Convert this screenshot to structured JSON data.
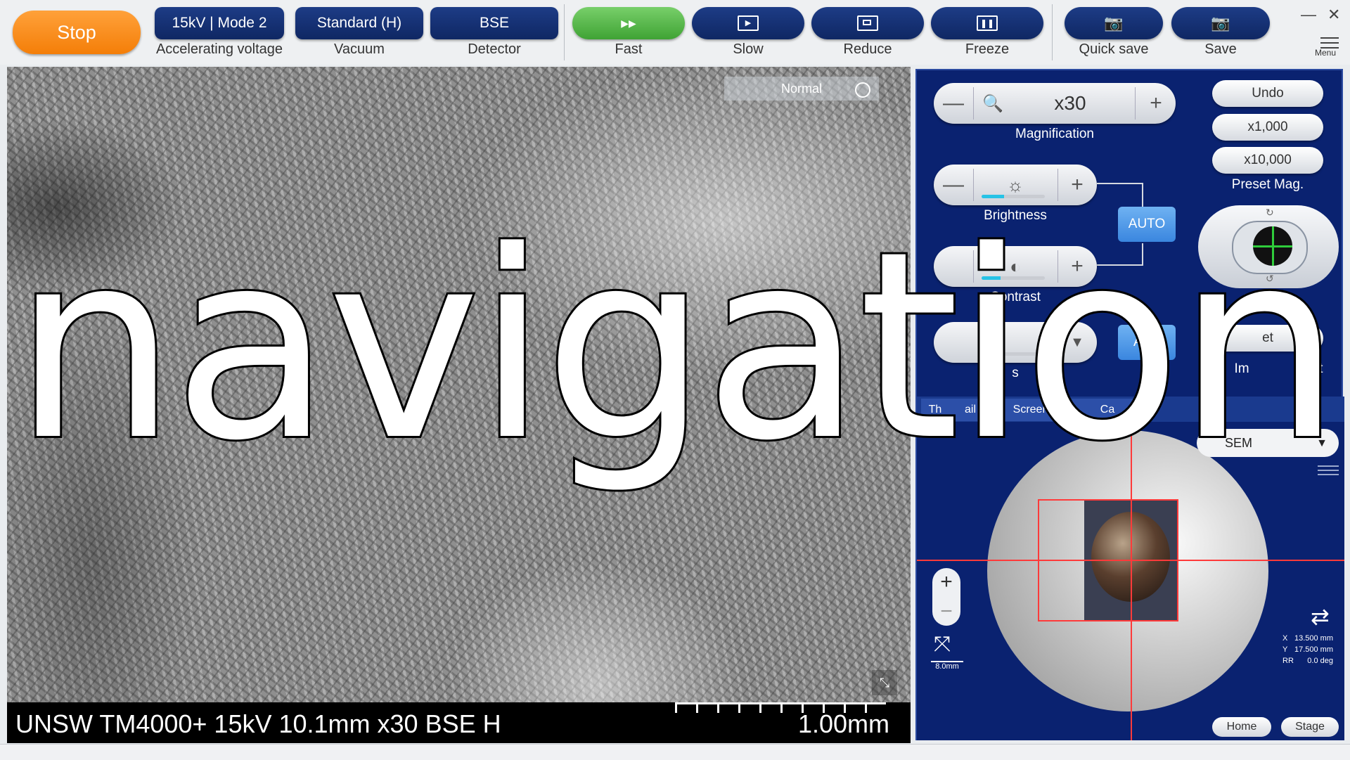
{
  "toolbar": {
    "stop_label": "Stop",
    "voltage_value": "15kV | Mode 2",
    "voltage_caption": "Accelerating voltage",
    "vacuum_value": "Standard (H)",
    "vacuum_caption": "Vacuum",
    "detector_value": "BSE",
    "detector_caption": "Detector",
    "fast_icon": "fast-forward-icon",
    "fast_label": "Fast",
    "slow_icon": "play-icon",
    "slow_label": "Slow",
    "reduce_icon": "reduce-window-icon",
    "reduce_label": "Reduce",
    "freeze_icon": "pause-icon",
    "freeze_label": "Freeze",
    "quick_save_icon": "camera-icon",
    "quick_save_label": "Quick save",
    "save_icon": "camera-3d-icon",
    "save_label": "Save",
    "menu_label": "Menu",
    "minimize_glyph": "—",
    "close_glyph": "✕"
  },
  "image": {
    "mode_label": "Normal",
    "info_text": "UNSW TM4000+ 15kV 10.1mm x30 BSE H",
    "scale_text": "1.00mm"
  },
  "panel": {
    "magnification": {
      "minus": "—",
      "value": "x30",
      "plus": "+",
      "caption": "Magnification"
    },
    "preset": {
      "undo": "Undo",
      "x1000": "x1,000",
      "x10000": "x10,000",
      "caption": "Preset Mag."
    },
    "brightness": {
      "minus": "—",
      "plus": "+",
      "caption": "Brightness",
      "level": 0.35
    },
    "contrast": {
      "plus": "+",
      "caption": "Contrast",
      "level": 0.3
    },
    "auto_label": "AUTO",
    "focus": {
      "caption_fragment": "s",
      "auto_fragment": "AUT",
      "level": 0.3
    },
    "image_shift": {
      "button_fragment": "et",
      "caption_left": "Im",
      "caption_right": "shift"
    },
    "rotation_caption": "Rotation",
    "tabs": [
      "Th",
      "ail",
      "Screen",
      "Ca"
    ],
    "stage": {
      "signal_select": "SEM",
      "scale_label": "8.0mm",
      "x_label": "X",
      "x_value": "13.500 mm",
      "y_label": "Y",
      "y_value": "17.500 mm",
      "r_label": "RR",
      "r_value": "0.0 deg",
      "home_label": "Home",
      "stage_label": "Stage"
    }
  },
  "overlay_caption": "navigation",
  "colors": {
    "stop_orange": "#f47e08",
    "fast_green": "#3fa334",
    "toolbar_navy": "#0f2763",
    "panel_navy": "#0a2270",
    "auto_blue": "#3a86df",
    "crosshair_red": "#ff3a3a"
  }
}
